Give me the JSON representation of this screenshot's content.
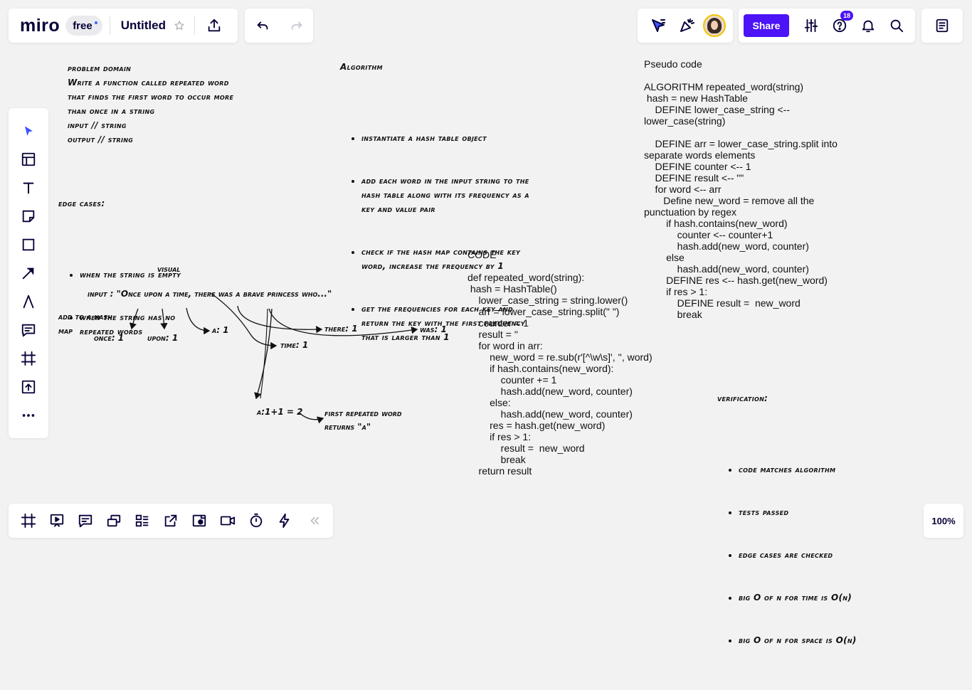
{
  "topbar": {
    "logo": "miro",
    "plan_badge": "free",
    "board_title": "Untitled",
    "share_label": "Share",
    "notification_count": "18"
  },
  "zoom": "100%",
  "board": {
    "problem_domain": {
      "title": "problem domain",
      "lines": [
        "Write a function called repeated word",
        "that finds the first word to occur more",
        "than once in a string",
        "input // string",
        "output // string"
      ]
    },
    "edge_cases": {
      "title": "edge cases:",
      "items": [
        "when the string is empty",
        "when the string has no\nrepeated words"
      ]
    },
    "algorithm": {
      "title": "Algorithm",
      "items": [
        "instantiate a hash table object",
        "add each word in the input string to the\nhash table along with its frequency as a\nkey and value pair",
        "check if the hash map contains the key\nword, increase the frequency by 1",
        "get the frequencies for each key and\nreturn the key with the first frequency\nthat is larger than 1"
      ]
    },
    "pseudo_code": {
      "title": "Pseudo code",
      "body": "ALGORITHM repeated_word(string)\n hash = new HashTable\n    DEFINE lower_case_string <--\nlower_case(string)\n\n    DEFINE arr = lower_case_string.split into\nseparate words elements\n    DEFINE counter <-- 1\n    DEFINE result <-- \"\"\n    for word <-- arr\n       Define new_word = remove all the\npunctuation by regex\n        if hash.contains(new_word)\n            counter <-- counter+1\n            hash.add(new_word, counter)\n        else\n            hash.add(new_word, counter)\n        DEFINE res <-- hash.get(new_word)\n        if res > 1:\n            DEFINE result =  new_word\n            break"
    },
    "code": {
      "title": "CODE",
      "body": "def repeated_word(string):\n hash = HashTable()\n    lower_case_string = string.lower()\n    arr = lower_case_string.split(\" \")\n    counter = 1\n    result = ''\n    for word in arr:\n        new_word = re.sub(r'[^\\w\\s]', '', word)\n        if hash.contains(new_word):\n            counter += 1\n            hash.add(new_word, counter)\n        else:\n            hash.add(new_word, counter)\n        res = hash.get(new_word)\n        if res > 1:\n            result =  new_word\n            break\n    return result"
    },
    "visual": {
      "title": "visual",
      "input": "input : \"Once upon a time, there was a brave princess who...\"",
      "add_label": "add to a hash\nmap",
      "nodes": [
        "once: 1",
        "upon: 1",
        "a: 1",
        "there: 1",
        "was: 1",
        "time: 1"
      ],
      "result": "a:1+1 = 2",
      "result_note": "first repeated word\nreturns \"a\""
    },
    "verification": {
      "title": "verification:",
      "items": [
        "code matches algorithm",
        "tests passed",
        "edge cases are checked",
        "big O of n for time is O(n)",
        "big O of n for space is O(n)"
      ]
    }
  }
}
